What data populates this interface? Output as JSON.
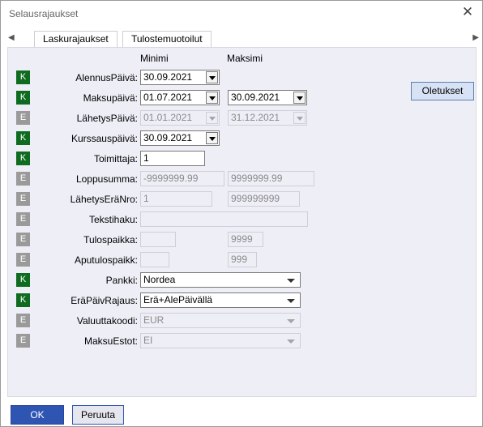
{
  "window": {
    "title": "Selausrajaukset"
  },
  "tabs": [
    {
      "label": "Laskurajaukset",
      "active": true
    },
    {
      "label": "Tulostemuotoilut",
      "active": false
    }
  ],
  "columns": {
    "min": "Minimi",
    "max": "Maksimi"
  },
  "default_button": "Oletukset",
  "rows": [
    {
      "badge": "K",
      "label": "AlennusPäivä:",
      "min": "30.09.2021",
      "max": ""
    },
    {
      "badge": "K",
      "label": "Maksupäivä:",
      "min": "01.07.2021",
      "max": "30.09.2021"
    },
    {
      "badge": "E",
      "label": "LähetysPäivä:",
      "min": "01.01.2021",
      "max": "31.12.2021"
    },
    {
      "badge": "K",
      "label": "Kurssauspäivä:",
      "min": "30.09.2021",
      "max": ""
    },
    {
      "badge": "K",
      "label": "Toimittaja:",
      "min": "1",
      "max": ""
    },
    {
      "badge": "E",
      "label": "Loppusumma:",
      "min": "-9999999.99",
      "max": "9999999.99"
    },
    {
      "badge": "E",
      "label": "LähetysEräNro:",
      "min": "1",
      "max": "999999999"
    },
    {
      "badge": "E",
      "label": "Tekstihaku:",
      "min": "",
      "max": ""
    },
    {
      "badge": "E",
      "label": "Tulospaikka:",
      "min": "",
      "max": "9999"
    },
    {
      "badge": "E",
      "label": "Aputulospaikk:",
      "min": "",
      "max": "999"
    },
    {
      "badge": "K",
      "label": "Pankki:",
      "min": "Nordea",
      "max": ""
    },
    {
      "badge": "K",
      "label": "EräPäivRajaus:",
      "min": "Erä+AlePäivällä",
      "max": ""
    },
    {
      "badge": "E",
      "label": "Valuuttakoodi:",
      "min": "EUR",
      "max": ""
    },
    {
      "badge": "E",
      "label": "MaksuEstot:",
      "min": "EI",
      "max": ""
    }
  ],
  "footer": {
    "ok": "OK",
    "cancel": "Peruuta"
  },
  "colors": {
    "badge_k": "#0f6b1f",
    "badge_e": "#9a9a9a",
    "ok_button": "#2f55b3",
    "panel_bg": "#eeeef7"
  }
}
